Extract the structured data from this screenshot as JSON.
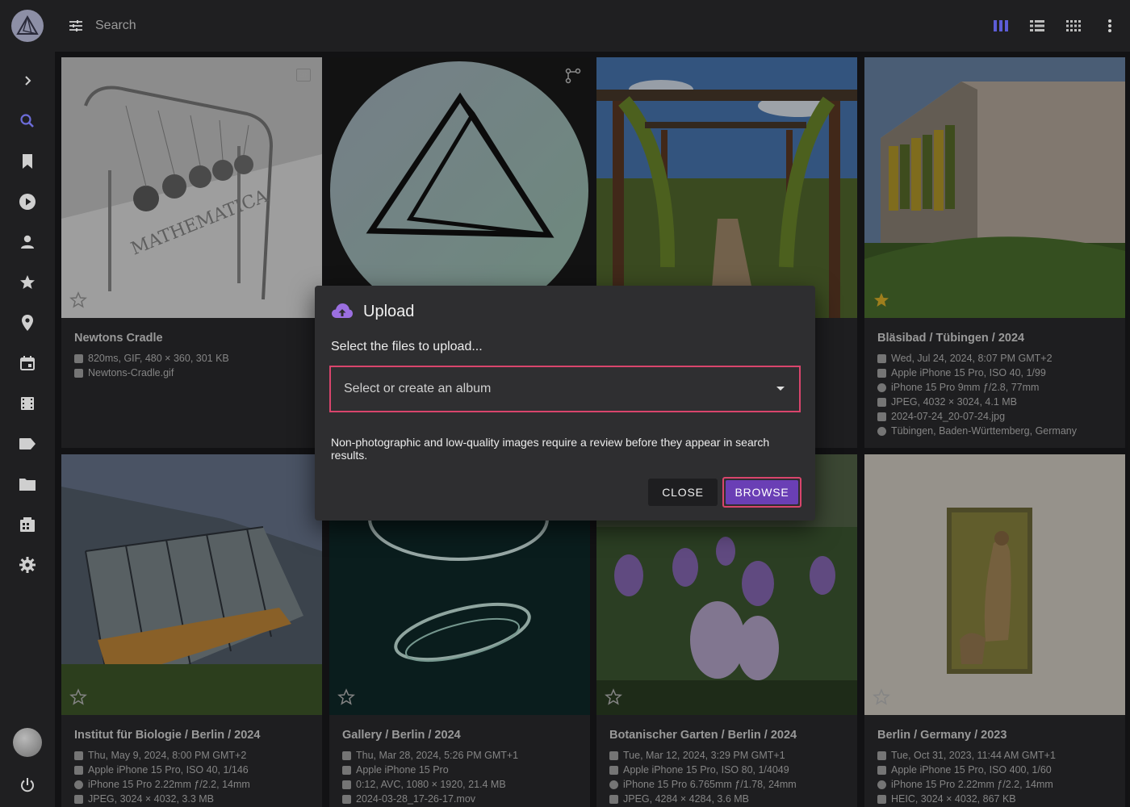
{
  "toolbar": {
    "search_placeholder": "Search"
  },
  "sidebar": {
    "items": [
      {
        "icon": "chevron-right-icon"
      },
      {
        "icon": "search-icon"
      },
      {
        "icon": "bookmark-icon"
      },
      {
        "icon": "play-icon"
      },
      {
        "icon": "person-icon"
      },
      {
        "icon": "star-icon"
      },
      {
        "icon": "location-icon"
      },
      {
        "icon": "calendar-icon"
      },
      {
        "icon": "film-icon"
      },
      {
        "icon": "label-icon"
      },
      {
        "icon": "folder-icon"
      },
      {
        "icon": "library-icon"
      },
      {
        "icon": "gear-icon"
      },
      {
        "icon": "power-icon"
      }
    ]
  },
  "cards": [
    {
      "title": "Newtons Cradle",
      "meta": [
        "820ms, GIF, 480 × 360, 301 KB",
        "Newtons-Cradle.gif"
      ]
    },
    {
      "title": "",
      "meta": []
    },
    {
      "title": "",
      "meta": []
    },
    {
      "title": "Bläsibad / Tübingen / 2024",
      "meta": [
        "Wed, Jul 24, 2024, 8:07 PM GMT+2",
        "Apple iPhone 15 Pro, ISO 40, 1/99",
        "iPhone 15 Pro 9mm ƒ/2.8, 77mm",
        "JPEG, 4032 × 3024, 4.1 MB",
        "2024-07-24_20-07-24.jpg",
        "Tübingen, Baden-Württemberg, Germany"
      ]
    },
    {
      "title": "Institut für Biologie / Berlin / 2024",
      "meta": [
        "Thu, May 9, 2024, 8:00 PM GMT+2",
        "Apple iPhone 15 Pro, ISO 40, 1/146",
        "iPhone 15 Pro 2.22mm ƒ/2.2, 14mm",
        "JPEG, 3024 × 4032, 3.3 MB"
      ]
    },
    {
      "title": "Gallery / Berlin / 2024",
      "meta": [
        "Thu, Mar 28, 2024, 5:26 PM GMT+1",
        "Apple iPhone 15 Pro",
        "0:12, AVC, 1080 × 1920, 21.4 MB",
        "2024-03-28_17-26-17.mov"
      ]
    },
    {
      "title": "Botanischer Garten / Berlin / 2024",
      "meta": [
        "Tue, Mar 12, 2024, 3:29 PM GMT+1",
        "Apple iPhone 15 Pro, ISO 80, 1/4049",
        "iPhone 15 Pro 6.765mm ƒ/1.78, 24mm",
        "JPEG, 4284 × 4284, 3.6 MB"
      ]
    },
    {
      "title": "Berlin / Germany / 2023",
      "meta": [
        "Tue, Oct 31, 2023, 11:44 AM GMT+1",
        "Apple iPhone 15 Pro, ISO 400, 1/60",
        "iPhone 15 Pro 2.22mm ƒ/2.2, 14mm",
        "HEIC, 3024 × 4032, 867 KB"
      ]
    }
  ],
  "badges": {
    "gif": "GIF"
  },
  "dialog": {
    "title": "Upload",
    "subtitle": "Select the files to upload...",
    "album_placeholder": "Select or create an album",
    "note": "Non-photographic and low-quality images require a review before they appear in search results.",
    "close_label": "CLOSE",
    "browse_label": "BROWSE"
  },
  "colors": {
    "accent": "#6a3fb5",
    "focus_outline": "#d9456c",
    "upload_icon": "#9b6fe0",
    "active_view": "#5c5cd6"
  }
}
